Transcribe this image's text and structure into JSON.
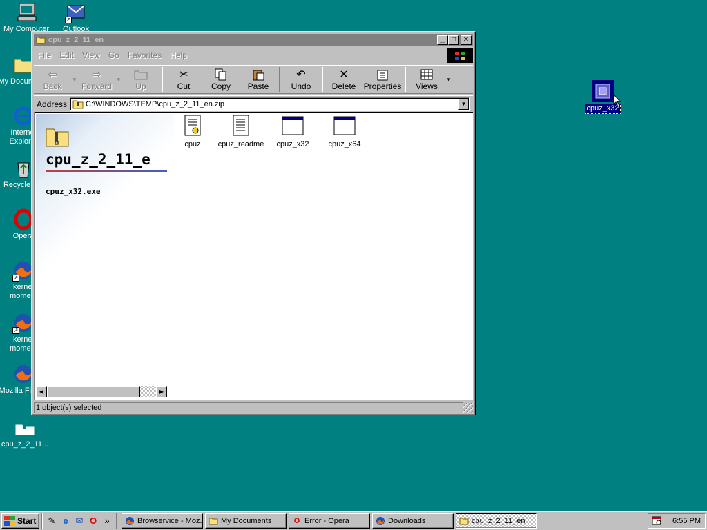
{
  "desktop": {
    "icons": [
      {
        "label": "My Computer",
        "icon": "computer-icon"
      },
      {
        "label": "Outlook",
        "icon": "outlook-icon"
      },
      {
        "label": "My Documents",
        "icon": "folder-icon"
      },
      {
        "label": "Internet Explorer",
        "icon": "ie-icon"
      },
      {
        "label": "Recycle Bin",
        "icon": "recycle-bin-icon"
      },
      {
        "label": "Opera",
        "icon": "opera-icon"
      },
      {
        "label": "kernel moment",
        "icon": "firefox-icon"
      },
      {
        "label": "kernel moment",
        "icon": "firefox-icon"
      },
      {
        "label": "Mozilla Firefox",
        "icon": "firefox-icon"
      },
      {
        "label": "cpu_z_2_11...",
        "icon": "zip-folder-icon"
      }
    ],
    "dragged_icon": {
      "label": "cpuz_x32",
      "icon": "cpu-icon"
    }
  },
  "window": {
    "title": "cpu_z_2_11_en",
    "menu": [
      "File",
      "Edit",
      "View",
      "Go",
      "Favorites",
      "Help"
    ],
    "toolbar": {
      "back": "Back",
      "forward": "Forward",
      "up": "Up",
      "cut": "Cut",
      "copy": "Copy",
      "paste": "Paste",
      "undo": "Undo",
      "delete": "Delete",
      "properties": "Properties",
      "views": "Views"
    },
    "address_label": "Address",
    "address_value": "C:\\WINDOWS\\TEMP\\cpu_z_2_11_en.zip",
    "webview": {
      "folder_name": "cpu_z_2_11_e",
      "selected_file": "cpuz_x32.exe"
    },
    "files": [
      {
        "name": "cpuz",
        "icon": "settings-file-icon"
      },
      {
        "name": "cpuz_readme",
        "icon": "text-file-icon"
      },
      {
        "name": "cpuz_x32",
        "icon": "application-icon"
      },
      {
        "name": "cpuz_x64",
        "icon": "application-icon"
      }
    ],
    "status": "1 object(s) selected"
  },
  "taskbar": {
    "start_label": "Start",
    "buttons": [
      {
        "label": "Browservice - Moz...",
        "icon": "firefox-icon"
      },
      {
        "label": "My Documents",
        "icon": "folder-icon"
      },
      {
        "label": "Error - Opera",
        "icon": "opera-icon"
      },
      {
        "label": "Downloads",
        "icon": "firefox-icon"
      },
      {
        "label": "cpu_z_2_11_en",
        "icon": "folder-icon"
      }
    ],
    "quicklaunch_more": "»",
    "clock": "6:55 PM"
  },
  "colors": {
    "desktop": "#008080",
    "selection": "#000080",
    "inactive_title": "#808080"
  }
}
